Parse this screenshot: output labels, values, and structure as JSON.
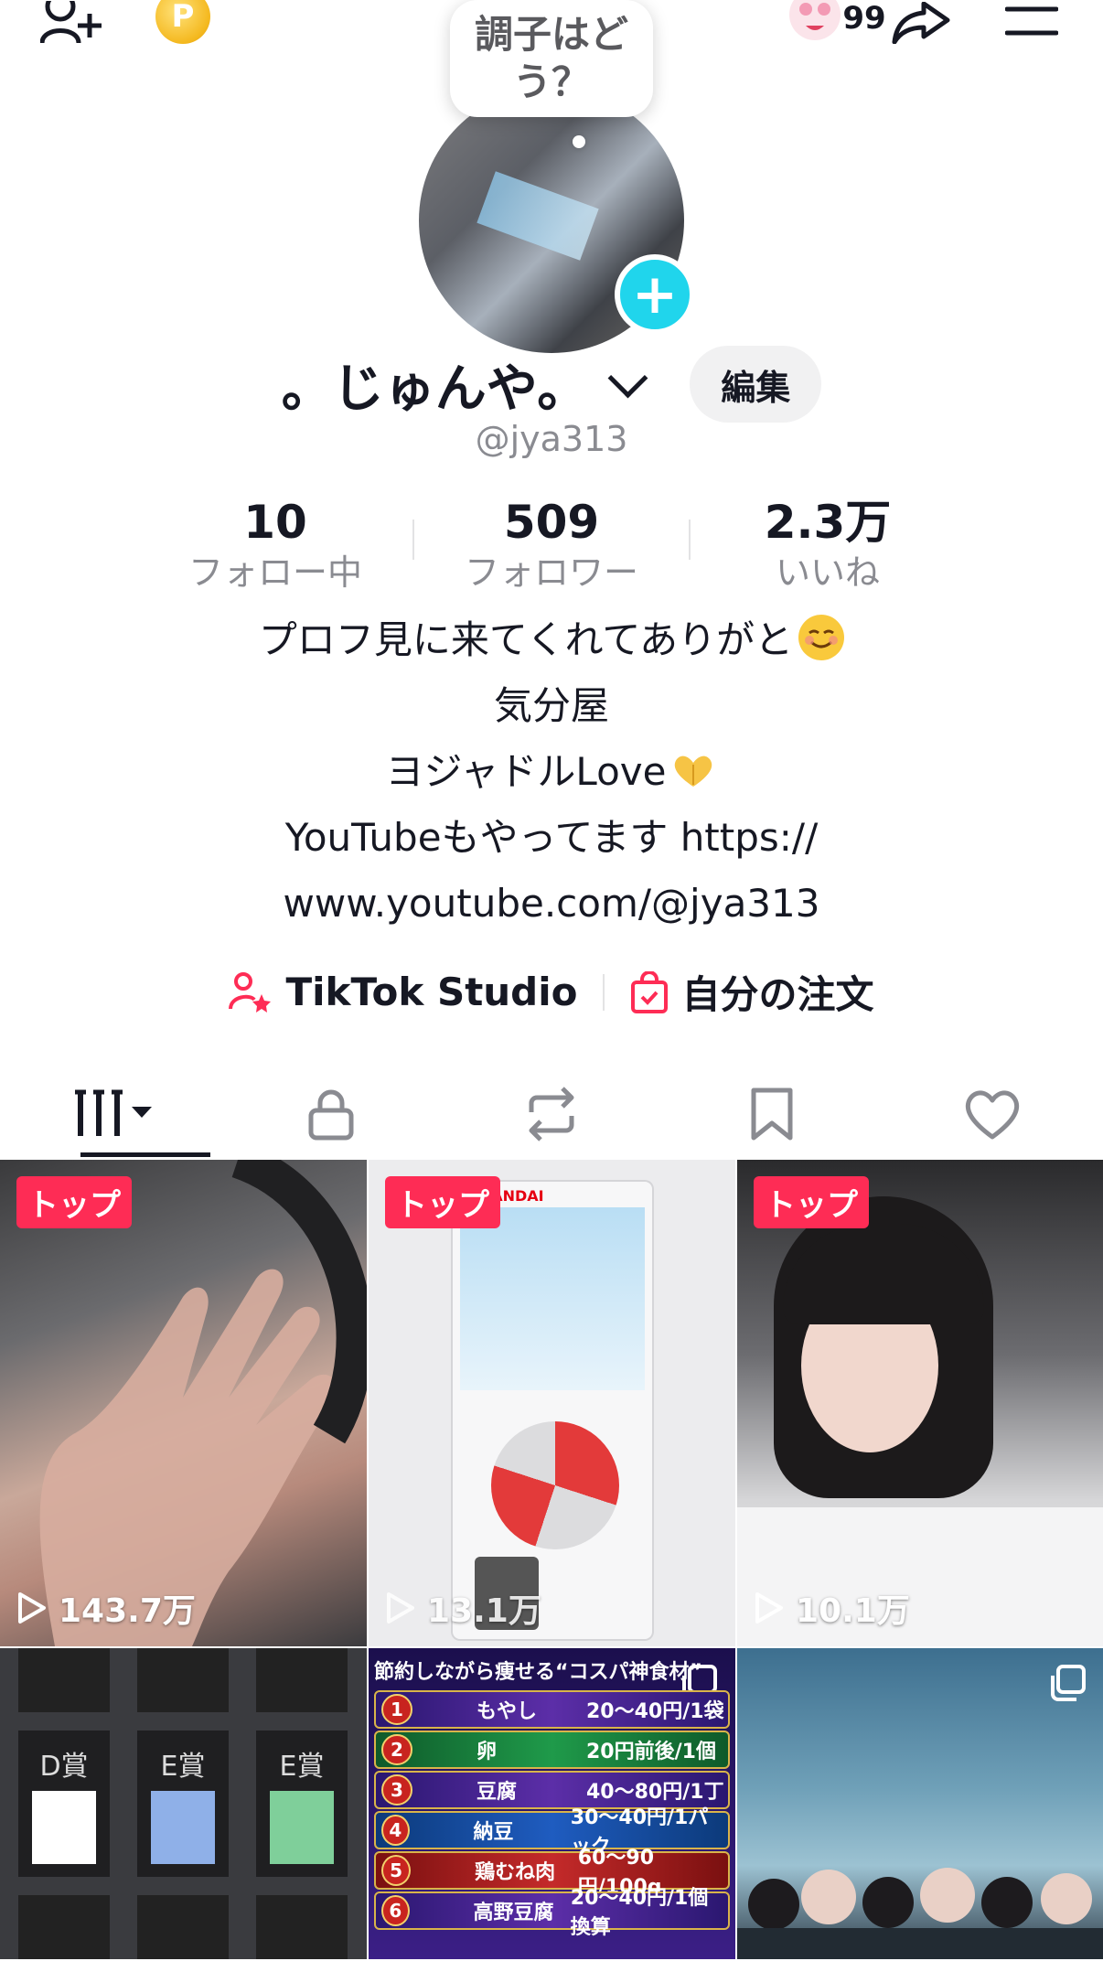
{
  "bubble": {
    "line1": "調子はど",
    "line2": "う？"
  },
  "topbar": {
    "notification_count": "99",
    "coin_glyph": "P"
  },
  "profile": {
    "display_name": "。じゅんや。",
    "edit_label": "編集",
    "handle": "@jya313"
  },
  "stats": [
    {
      "value": "10",
      "label": "フォロー中"
    },
    {
      "value": "509",
      "label": "フォロワー"
    },
    {
      "value": "2.3万",
      "label": "いいね"
    }
  ],
  "bio": {
    "line1": "プロフ見に来てくれてありがと",
    "line2": "気分屋",
    "line3": "ヨジャドルLove",
    "line4": "YouTubeもやってます https://",
    "line5": "www.youtube.com/@jya313"
  },
  "links": {
    "studio": "TikTok Studio",
    "orders": "自分の注文"
  },
  "videos": [
    {
      "badge": "トップ",
      "views": "143.7万"
    },
    {
      "badge": "トップ",
      "views": "13.1万",
      "brand": "BANDAI"
    },
    {
      "badge": "トップ",
      "views": "10.1万"
    }
  ],
  "food_tile": {
    "title": "節約しながら痩せる“コスパ神食材”",
    "items": [
      {
        "no": "1",
        "name": "もやし",
        "price": "20〜40円/1袋"
      },
      {
        "no": "2",
        "name": "卵",
        "price": "20円前後/1個"
      },
      {
        "no": "3",
        "name": "豆腐",
        "price": "40〜80円/1丁"
      },
      {
        "no": "4",
        "name": "納豆",
        "price": "30〜40円/1パック"
      },
      {
        "no": "5",
        "name": "鶏むね肉",
        "price": "60〜90円/100g"
      },
      {
        "no": "6",
        "name": "高野豆腐",
        "price": "20〜40円/1個換算"
      }
    ]
  },
  "sticker_tile": {
    "labels": [
      "D賞",
      "E賞",
      "E賞"
    ]
  },
  "colors": {
    "accent": "#fe2c55",
    "plus": "#20d5ec",
    "muted": "#8a8b91"
  }
}
